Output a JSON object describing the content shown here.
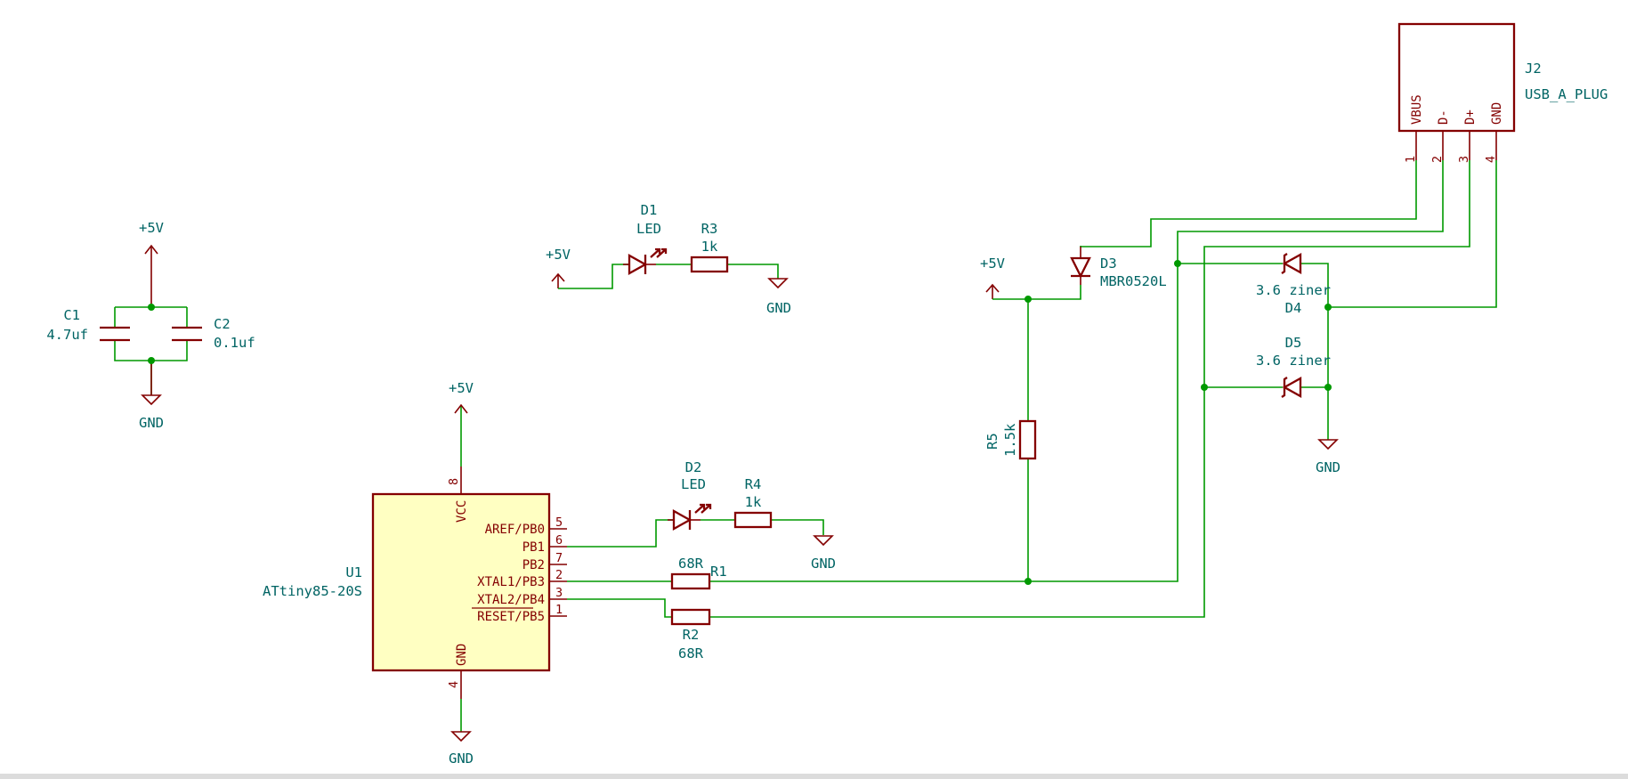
{
  "components": {
    "c1": {
      "ref": "C1",
      "value": "4.7uf"
    },
    "c2": {
      "ref": "C2",
      "value": "0.1uf"
    },
    "d1": {
      "ref": "D1",
      "value": "LED"
    },
    "d2": {
      "ref": "D2",
      "value": "LED"
    },
    "d3": {
      "ref": "D3",
      "value": "MBR0520L"
    },
    "d4": {
      "ref": "D4",
      "value": "3.6 ziner"
    },
    "d5": {
      "ref": "D5",
      "value": "3.6 ziner"
    },
    "r1": {
      "ref": "R1",
      "value": "68R"
    },
    "r2": {
      "ref": "R2",
      "value": "68R"
    },
    "r3": {
      "ref": "R3",
      "value": "1k"
    },
    "r4": {
      "ref": "R4",
      "value": "1k"
    },
    "r5": {
      "ref": "R5",
      "value": "1.5k"
    },
    "u1": {
      "ref": "U1",
      "value": "ATtiny85-20S",
      "pins": {
        "vcc": {
          "name": "VCC",
          "num": "8"
        },
        "gnd": {
          "name": "GND",
          "num": "4"
        },
        "pb0": {
          "name": "AREF/PB0",
          "num": "5"
        },
        "pb1": {
          "name": "PB1",
          "num": "6"
        },
        "pb2": {
          "name": "PB2",
          "num": "7"
        },
        "pb3": {
          "name": "XTAL1/PB3",
          "num": "2"
        },
        "pb4": {
          "name": "XTAL2/PB4",
          "num": "3"
        },
        "pb5": {
          "name": "RESET/PB5",
          "num": "1"
        }
      }
    },
    "j2": {
      "ref": "J2",
      "value": "USB_A_PLUG",
      "pins": {
        "vbus": {
          "name": "VBUS",
          "num": "1"
        },
        "dm": {
          "name": "D-",
          "num": "2"
        },
        "dp": {
          "name": "D+",
          "num": "3"
        },
        "gnd": {
          "name": "GND",
          "num": "4"
        }
      }
    }
  },
  "power": {
    "vcc_label": "+5V",
    "gnd_label": "GND"
  },
  "colors": {
    "wire": "#009900",
    "symbol": "#840000",
    "text": "#006464",
    "ic_fill": "#ffffc2"
  }
}
